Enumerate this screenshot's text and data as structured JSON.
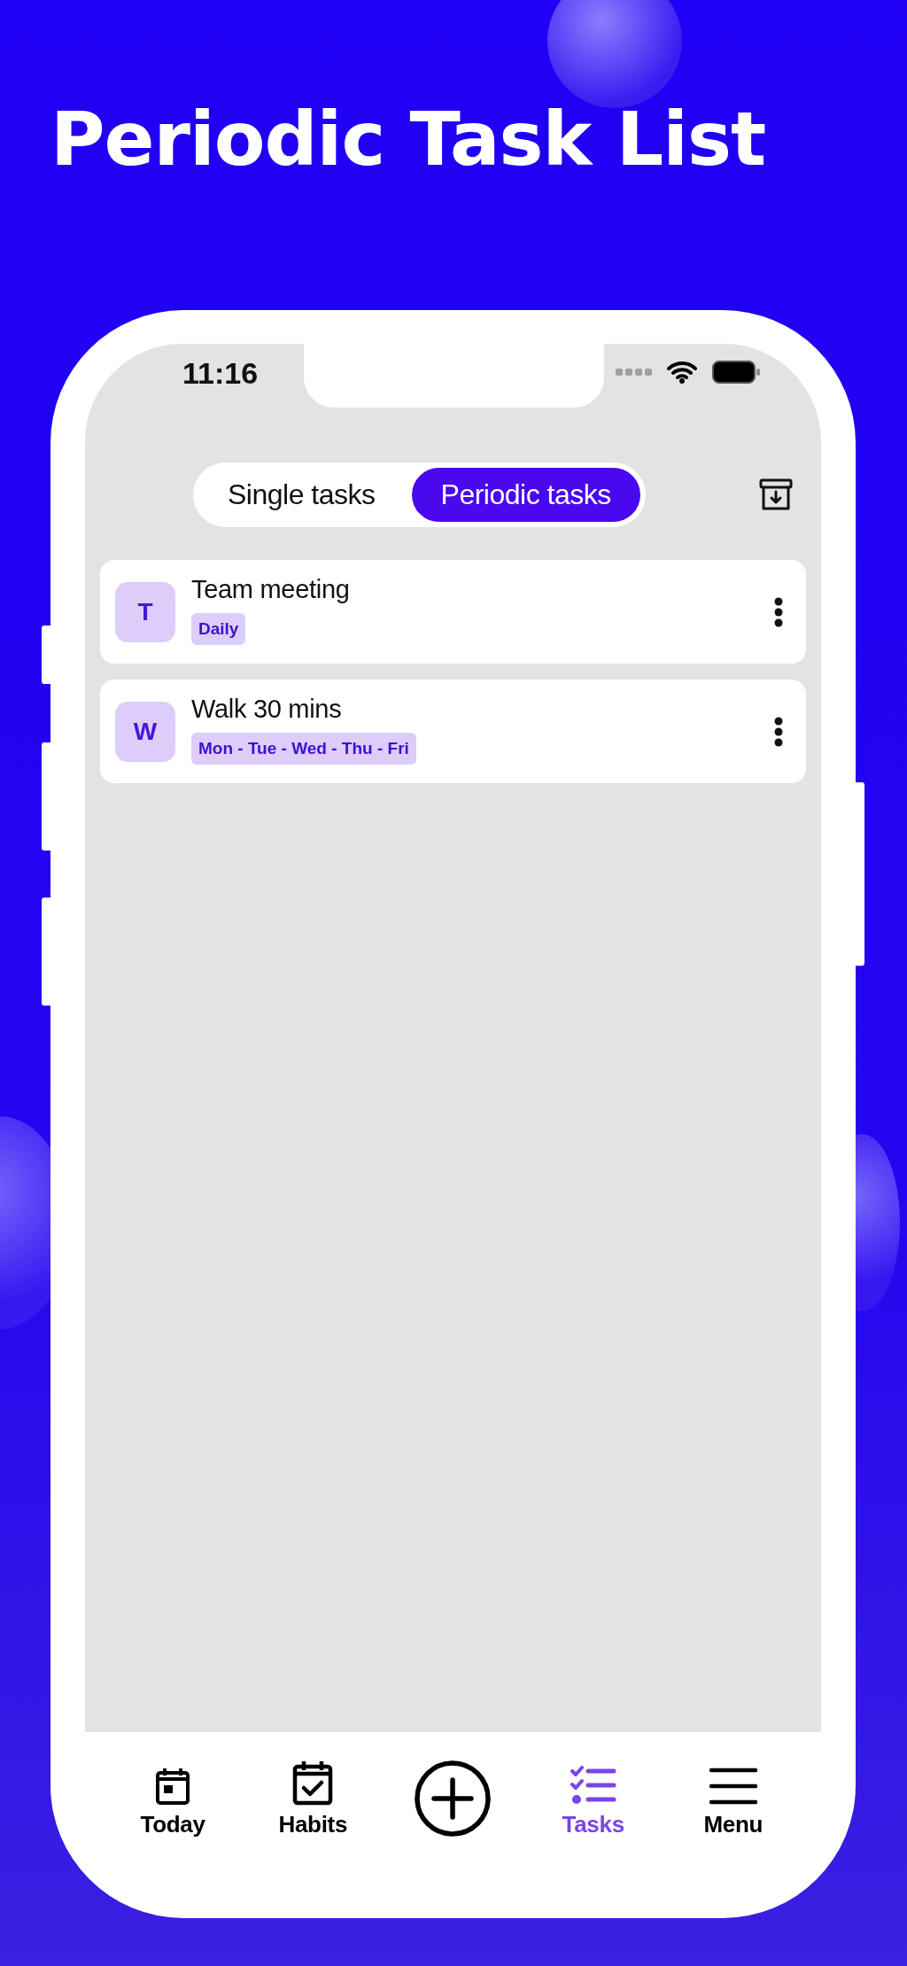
{
  "header": {
    "title": "Periodic Task List"
  },
  "status_bar": {
    "time": "11:16"
  },
  "segments": [
    {
      "label": "Single tasks",
      "selected": false
    },
    {
      "label": "Periodic tasks",
      "selected": true
    }
  ],
  "tasks": [
    {
      "initial": "T",
      "title": "Team meeting",
      "schedule": "Daily"
    },
    {
      "initial": "W",
      "title": "Walk 30 mins",
      "schedule": "Mon - Tue - Wed - Thu - Fri"
    }
  ],
  "tab_bar": [
    {
      "kind": "today",
      "label": "Today",
      "selected": false
    },
    {
      "kind": "habits",
      "label": "Habits",
      "selected": false
    },
    {
      "kind": "add",
      "selected": false
    },
    {
      "kind": "tasks",
      "label": "Tasks",
      "selected": true
    },
    {
      "kind": "menu",
      "label": "Menu",
      "selected": false
    }
  ]
}
